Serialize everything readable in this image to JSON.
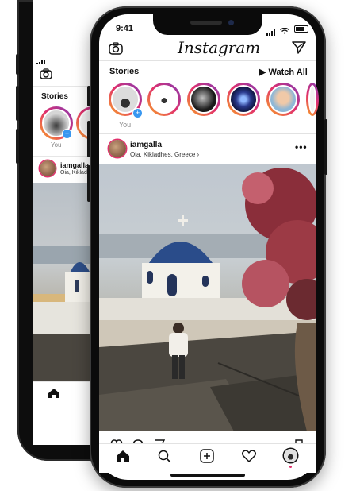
{
  "status_bar": {
    "time": "9:41"
  },
  "header": {
    "app_title": "Instagram",
    "camera_icon": "camera-icon",
    "direct_icon": "paper-plane-icon"
  },
  "stories": {
    "label": "Stories",
    "watch_all": "▶ Watch All",
    "your_label": "You",
    "items": [
      {
        "name": "your-story"
      },
      {
        "name": "story-1"
      },
      {
        "name": "story-2"
      },
      {
        "name": "story-3"
      },
      {
        "name": "story-4"
      }
    ]
  },
  "post": {
    "username": "iamgalla",
    "location": "Oia, Kikladhes, Greece ›",
    "more": "•••"
  },
  "tabbar": {
    "items": [
      "home-icon",
      "search-icon",
      "add-post-icon",
      "heart-icon",
      "profile-icon"
    ]
  },
  "back_phone": {
    "stories_label": "Stories",
    "you_label": "You",
    "username": "iamgalla",
    "location": "Oia, Kiklad"
  },
  "colors": {
    "story_ring": [
      "#f9a825",
      "#e1306c",
      "#833ab4"
    ],
    "accent_blue": "#3897f0"
  }
}
